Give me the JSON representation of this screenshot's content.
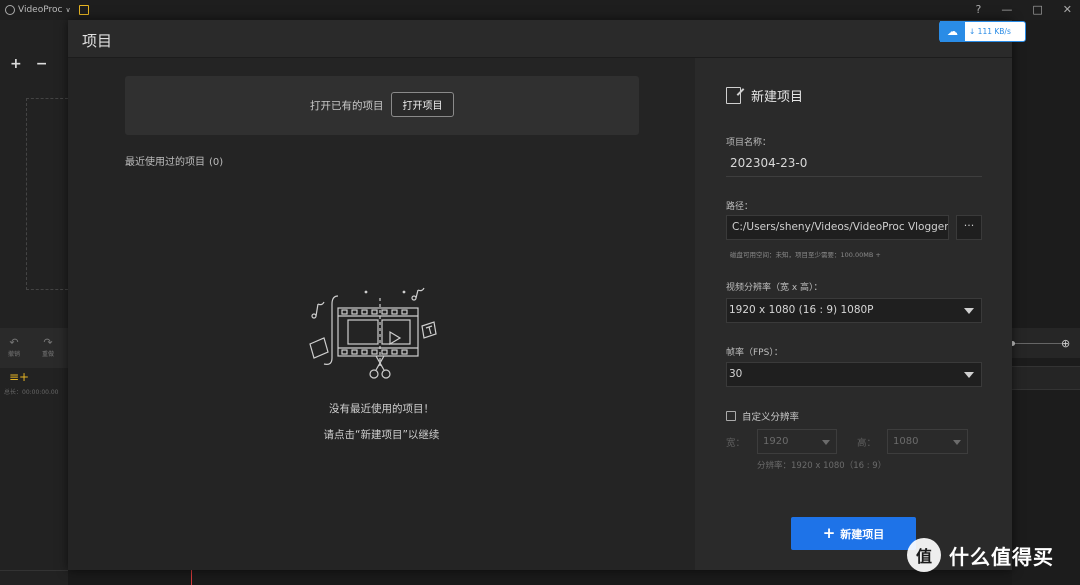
{
  "app": {
    "name": "VideoProc",
    "window_controls": [
      "?",
      "—",
      "□",
      "✕"
    ]
  },
  "left_rail": {
    "add": "+",
    "remove": "−",
    "undo_label": "撤销",
    "redo_label": "重做",
    "time": "总长：00:00:00.00"
  },
  "modal": {
    "title": "项目",
    "open_existing_label": "打开已有的项目",
    "open_button": "打开项目",
    "recent_title": "最近使用过的项目",
    "recent_count": "(0)",
    "empty_line1": "没有最近使用的项目！",
    "empty_line2": "请点击“新建项目”以继续"
  },
  "new_project": {
    "header": "新建项目",
    "name_label": "项目名称：",
    "name_value": "202304-23-0",
    "path_label": "路径：",
    "path_value": "C:/Users/sheny/Videos/VideoProc Vlogger/Projects",
    "path_button": "···",
    "disk_info": "磁盘可用空间：未知，项目至少需要：100.00MB +",
    "resolution_label": "视频分辨率（宽 x 高）：",
    "resolution_value": "1920 x 1080   (16 : 9)   1080P",
    "fps_label": "帧率（FPS）：",
    "fps_value": "30",
    "custom_res_label": "自定义分辨率",
    "width_label": "宽：",
    "width_value": "1920",
    "height_label": "高：",
    "height_value": "1080",
    "res_hint": "分辨率：1920 x 1080（16 : 9）",
    "create_button": "新建项目"
  },
  "speed_widget": {
    "speed": "111 KB/s"
  },
  "watermark": {
    "logo_text": "值",
    "text": "什么值得买"
  },
  "colors": {
    "accent": "#1e73e8",
    "save_icon": "#e6b422",
    "playhead": "#d23a3a"
  }
}
